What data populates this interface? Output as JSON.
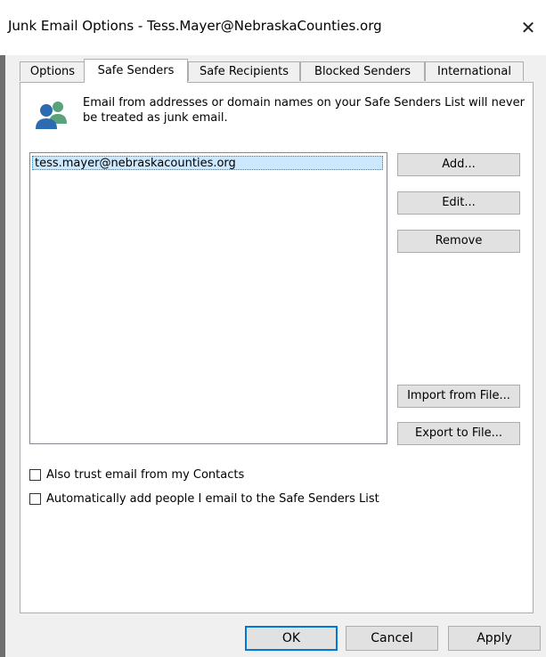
{
  "window": {
    "title": "Junk Email Options - Tess.Mayer@NebraskaCounties.org",
    "close_glyph": "✕"
  },
  "tabs": [
    {
      "label": "Options",
      "active": false
    },
    {
      "label": "Safe Senders",
      "active": true
    },
    {
      "label": "Safe Recipients",
      "active": false
    },
    {
      "label": "Blocked Senders",
      "active": false
    },
    {
      "label": "International",
      "active": false
    }
  ],
  "panel": {
    "icon": "people-icon",
    "description": "Email from addresses or domain names on your Safe Senders List will never be treated as junk email.",
    "list_items": [
      "tess.mayer@nebraskacounties.org"
    ],
    "buttons": {
      "add": "Add...",
      "edit": "Edit...",
      "remove": "Remove",
      "import": "Import from File...",
      "export": "Export to File..."
    },
    "checkboxes": [
      {
        "label": "Also trust email from my Contacts",
        "checked": false
      },
      {
        "label": "Automatically add people I email to the Safe Senders List",
        "checked": false
      }
    ]
  },
  "footer": {
    "ok": "OK",
    "cancel": "Cancel",
    "apply": "Apply"
  },
  "colors": {
    "selection": "#cce8ff",
    "default_button_border": "#0078d7",
    "icon_blue": "#2b6cb0",
    "icon_green": "#5aa37a"
  }
}
